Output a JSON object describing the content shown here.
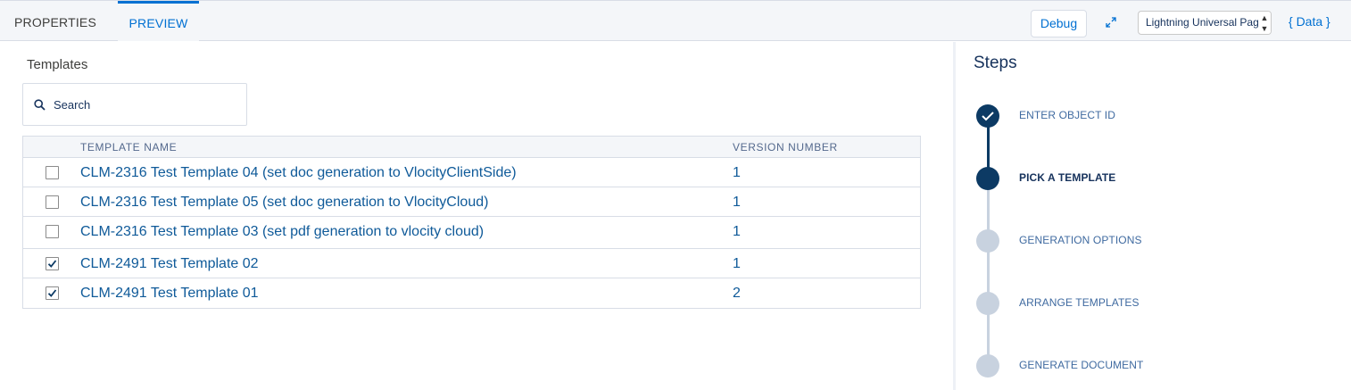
{
  "topbar": {
    "tabs": [
      {
        "label": "PROPERTIES",
        "active": false
      },
      {
        "label": "PREVIEW",
        "active": true
      }
    ],
    "debug_label": "Debug",
    "expand_icon": "expand-icon",
    "layout_select_value": "Lightning Universal Page",
    "data_label": "{ Data }",
    "accent_color": "#0070d2"
  },
  "templates": {
    "title": "Templates",
    "search_placeholder": "Search",
    "columns": [
      "TEMPLATE NAME",
      "VERSION NUMBER"
    ],
    "rows": [
      {
        "name": "CLM-2316 Test Template 04 (set doc generation to VlocityClientSide)",
        "version": "1",
        "checked": false
      },
      {
        "name": "CLM-2316 Test Template 05 (set doc generation to VlocityCloud)",
        "version": "1",
        "checked": false
      },
      {
        "name": "CLM-2316 Test Template 03 (set pdf generation to vlocity cloud)",
        "version": "1",
        "checked": false
      },
      {
        "name": "CLM-2491 Test Template 02",
        "version": "1",
        "checked": true
      },
      {
        "name": "CLM-2491 Test Template 01",
        "version": "2",
        "checked": true
      }
    ]
  },
  "steps": {
    "title": "Steps",
    "items": [
      {
        "label": "ENTER OBJECT ID",
        "status": "done"
      },
      {
        "label": "PICK A TEMPLATE",
        "status": "current"
      },
      {
        "label": "GENERATION OPTIONS",
        "status": "todo"
      },
      {
        "label": "ARRANGE TEMPLATES",
        "status": "todo"
      },
      {
        "label": "GENERATE DOCUMENT",
        "status": "todo"
      }
    ]
  }
}
